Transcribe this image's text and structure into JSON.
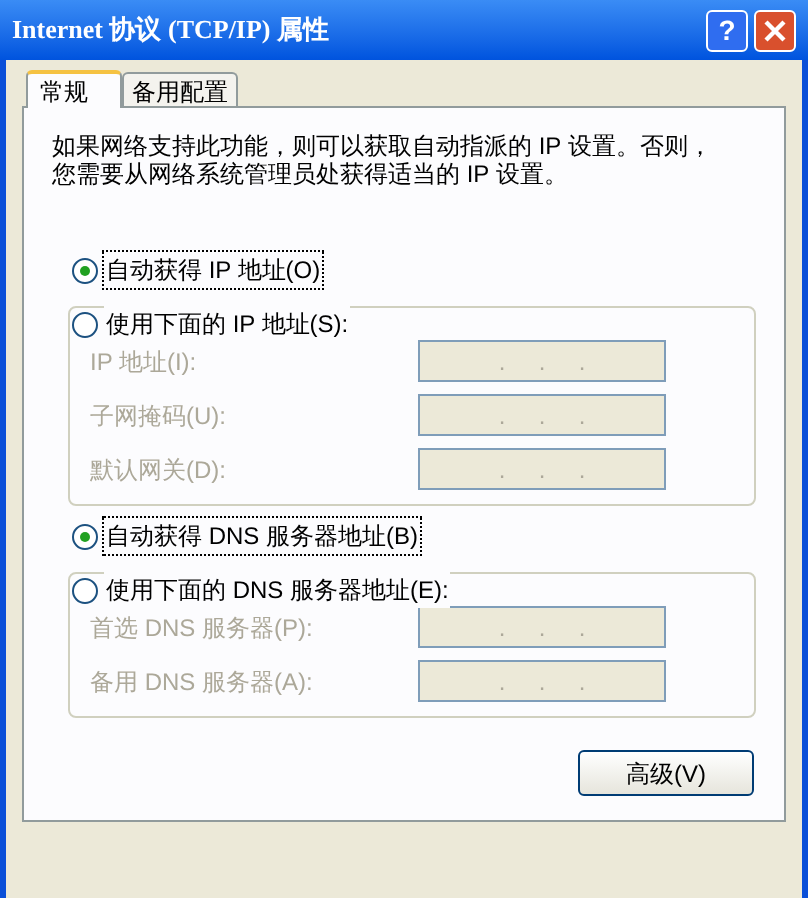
{
  "window": {
    "title": "Internet 协议 (TCP/IP) 属性",
    "help_button": "?"
  },
  "tabs": [
    {
      "label": "常规",
      "selected": true
    },
    {
      "label": "备用配置",
      "selected": false
    }
  ],
  "description_lines": [
    "如果网络支持此功能，则可以获取自动指派的 IP 设置。否则，",
    "您需要从网络系统管理员处获得适当的 IP 设置。"
  ],
  "sections": [
    {
      "options": [
        {
          "label": "自动获得 IP 地址(O)",
          "selected": true
        },
        {
          "label": "使用下面的 IP 地址(S):",
          "selected": false
        }
      ],
      "fields": [
        {
          "label": "IP 地址(I):",
          "disabled": true,
          "value": ".     .     ."
        },
        {
          "label": "子网掩码(U):",
          "disabled": true,
          "value": ".     .     ."
        },
        {
          "label": "默认网关(D):",
          "disabled": true,
          "value": ".     .     ."
        }
      ]
    },
    {
      "options": [
        {
          "label": "自动获得 DNS 服务器地址(B)",
          "selected": true
        },
        {
          "label": "使用下面的 DNS 服务器地址(E):",
          "selected": false
        }
      ],
      "fields": [
        {
          "label": "首选 DNS 服务器(P):",
          "disabled": true,
          "value": ".     .     ."
        },
        {
          "label": "备用 DNS 服务器(A):",
          "disabled": true,
          "value": ".     .     ."
        }
      ]
    }
  ],
  "buttons": [
    "高级(V)"
  ]
}
